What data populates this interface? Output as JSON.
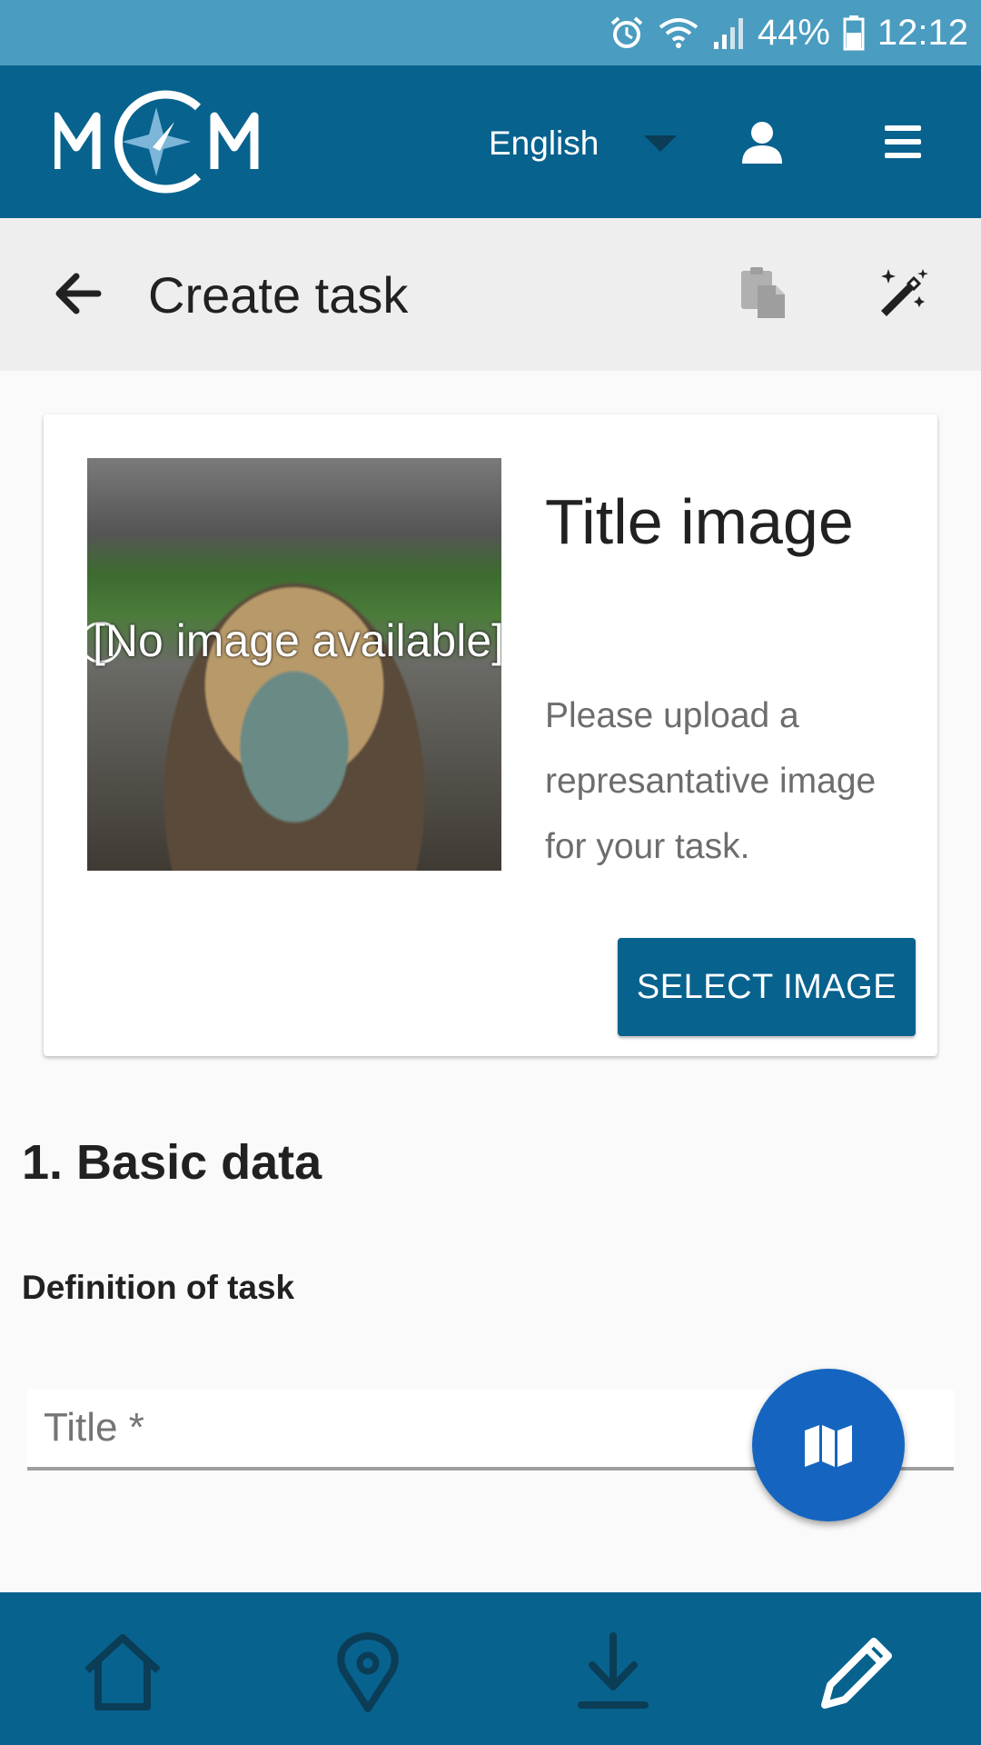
{
  "status_bar": {
    "battery": "44%",
    "time": "12:12",
    "icons": [
      "alarm-icon",
      "wifi-icon",
      "signal-icon",
      "battery-icon"
    ]
  },
  "header": {
    "logo_text": "MCM",
    "language": "English",
    "icons": [
      "user-icon",
      "menu-icon"
    ]
  },
  "toolbar": {
    "title": "Create task",
    "icons": [
      "back-arrow-icon",
      "paste-icon",
      "magic-wand-icon"
    ]
  },
  "title_image_card": {
    "image_alt": "[No image available]",
    "heading": "Title image",
    "description": "Please upload a represantative image for your task.",
    "button_label": "SELECT IMAGE"
  },
  "form": {
    "section_heading": "1. Basic data",
    "subheading": "Definition of task",
    "title_field_label": "Title *",
    "title_field_value": ""
  },
  "fab": {
    "icon": "map-icon"
  },
  "bottom_nav": {
    "items": [
      {
        "icon": "home-icon"
      },
      {
        "icon": "location-pin-icon"
      },
      {
        "icon": "download-icon"
      },
      {
        "icon": "pencil-icon",
        "active": true
      }
    ]
  },
  "colors": {
    "primary": "#07628e",
    "status_bar": "#4a9cc0",
    "fab": "#1565c0",
    "toolbar_bg": "#eeeeee"
  }
}
